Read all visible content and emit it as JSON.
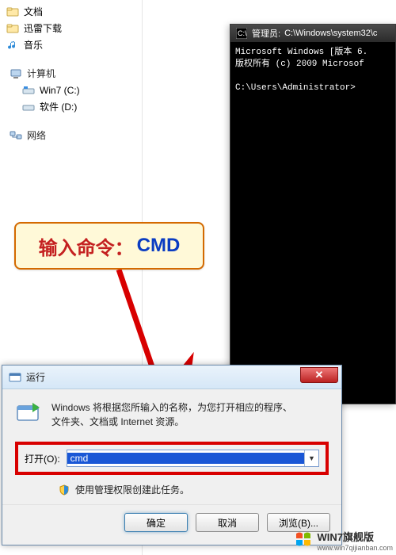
{
  "sidebar": {
    "groups": [
      {
        "items": [
          {
            "label": "文档"
          },
          {
            "label": "迅雷下载"
          },
          {
            "label": "音乐"
          }
        ]
      },
      {
        "label": "计算机",
        "items": [
          {
            "label": "Win7 (C:)"
          },
          {
            "label": "软件 (D:)"
          }
        ]
      },
      {
        "label": "网络",
        "items": []
      }
    ]
  },
  "terminal": {
    "title_prefix": "管理员: ",
    "title_path": "C:\\Windows\\system32\\c",
    "line1": "Microsoft Windows [版本 6.",
    "line2": "版权所有 (c) 2009 Microsof",
    "prompt": "C:\\Users\\Administrator>"
  },
  "callout": {
    "part1": "输入命令：",
    "part2": "CMD"
  },
  "run": {
    "title": "运行",
    "description_line1": "Windows 将根据您所输入的名称，为您打开相应的程序、",
    "description_line2": "文件夹、文档或 Internet 资源。",
    "open_label": "打开(O):",
    "open_value": "cmd",
    "admin_text": "使用管理权限创建此任务。",
    "buttons": {
      "ok": "确定",
      "cancel": "取消",
      "browse": "浏览(B)..."
    }
  },
  "watermark": {
    "text": "WIN7旗舰版",
    "url": "www.win7qijianban.com"
  }
}
